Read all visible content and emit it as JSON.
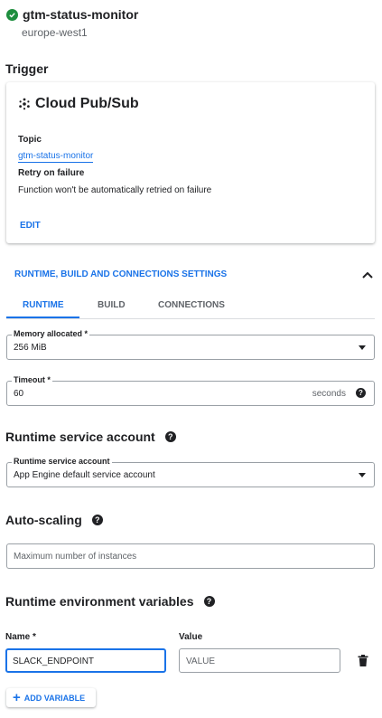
{
  "header": {
    "function_name": "gtm-status-monitor",
    "region": "europe-west1",
    "status_icon": "check-circle-icon"
  },
  "trigger": {
    "section_title": "Trigger",
    "type_title": "Cloud Pub/Sub",
    "topic_label": "Topic",
    "topic_value": "gtm-status-monitor",
    "retry_label": "Retry on failure",
    "retry_value": "Function won't be automatically retried on failure",
    "edit_label": "EDIT"
  },
  "runtime_settings": {
    "header_label": "RUNTIME, BUILD AND CONNECTIONS SETTINGS",
    "tabs": [
      {
        "label": "RUNTIME",
        "active": true
      },
      {
        "label": "BUILD",
        "active": false
      },
      {
        "label": "CONNECTIONS",
        "active": false
      }
    ],
    "memory": {
      "label": "Memory allocated *",
      "value": "256 MiB"
    },
    "timeout": {
      "label": "Timeout *",
      "value": "60",
      "suffix": "seconds"
    }
  },
  "service_account": {
    "section_title": "Runtime service account",
    "label": "Runtime service account",
    "value": "App Engine default service account"
  },
  "autoscaling": {
    "section_title": "Auto-scaling",
    "placeholder": "Maximum number of instances"
  },
  "env_vars": {
    "section_title": "Runtime environment variables",
    "name_label": "Name *",
    "value_label": "Value",
    "name_value": "SLACK_ENDPOINT",
    "value_placeholder": "VALUE",
    "add_label": "ADD VARIABLE"
  },
  "colors": {
    "accent": "#1a73e8",
    "success": "#1e8e3e",
    "text": "#202124"
  }
}
